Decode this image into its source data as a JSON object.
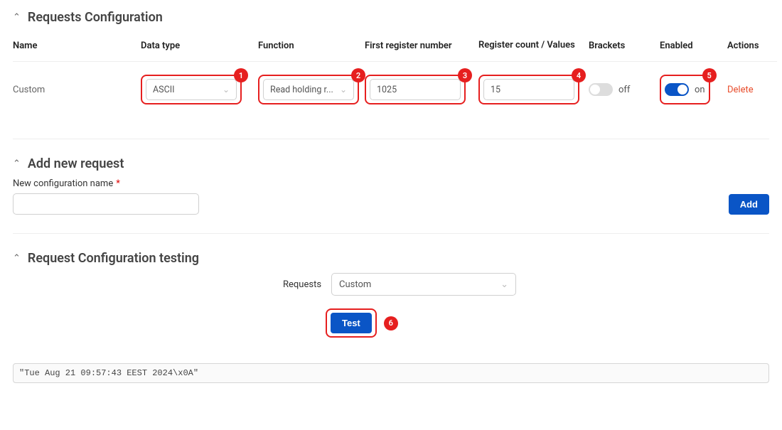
{
  "sections": {
    "requests_config": "Requests Configuration",
    "add_new": "Add new request",
    "testing": "Request Configuration testing"
  },
  "table": {
    "headers": {
      "name": "Name",
      "data_type": "Data type",
      "function": "Function",
      "first_reg": "First register number",
      "reg_count": "Register count / Values",
      "brackets": "Brackets",
      "enabled": "Enabled",
      "actions": "Actions"
    },
    "row": {
      "name": "Custom",
      "data_type": "ASCII",
      "function": "Read holding r...",
      "first_reg": "1025",
      "reg_count": "15",
      "brackets_state": "off",
      "enabled_state": "on",
      "delete": "Delete"
    }
  },
  "badges": {
    "b1": "1",
    "b2": "2",
    "b3": "3",
    "b4": "4",
    "b5": "5",
    "b6": "6"
  },
  "add_form": {
    "label": "New configuration name",
    "value": "",
    "add_btn": "Add"
  },
  "testing": {
    "label": "Requests",
    "selected": "Custom",
    "test_btn": "Test"
  },
  "log": "\"Tue Aug 21 09:57:43 EEST 2024\\x0A\""
}
